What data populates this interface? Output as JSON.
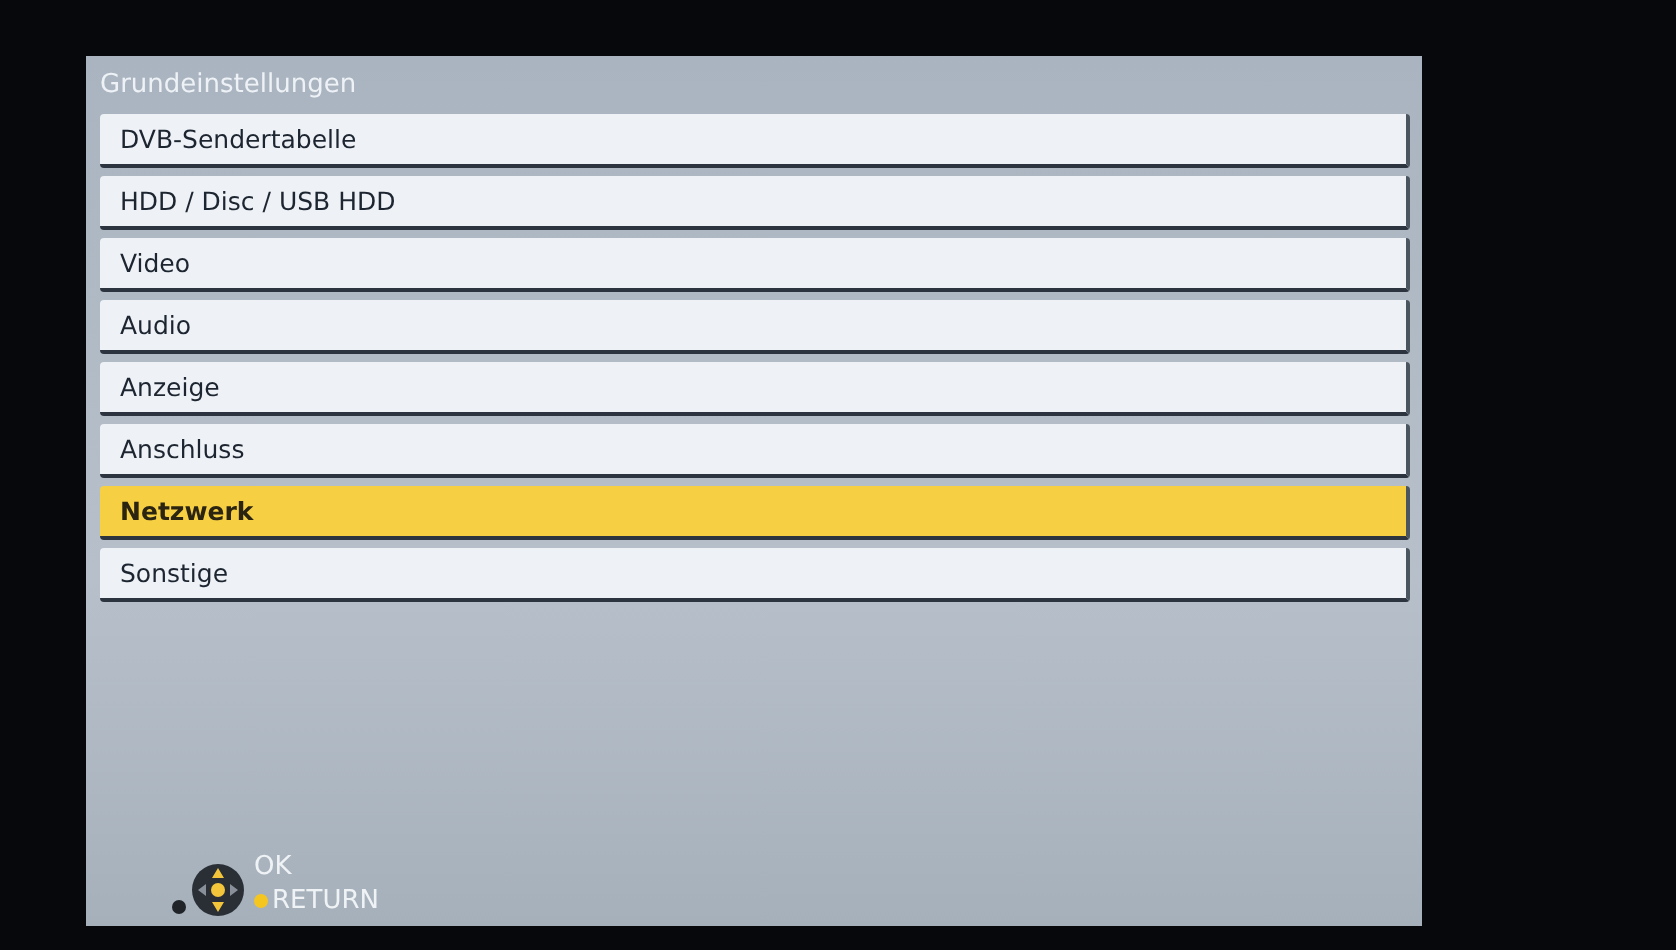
{
  "menu": {
    "title": "Grundeinstellungen",
    "items": [
      {
        "label": "DVB-Sendertabelle",
        "selected": false
      },
      {
        "label": "HDD / Disc / USB HDD",
        "selected": false
      },
      {
        "label": "Video",
        "selected": false
      },
      {
        "label": "Audio",
        "selected": false
      },
      {
        "label": "Anzeige",
        "selected": false
      },
      {
        "label": "Anschluss",
        "selected": false
      },
      {
        "label": "Netzwerk",
        "selected": true
      },
      {
        "label": "Sonstige",
        "selected": false
      }
    ]
  },
  "footer": {
    "ok_label": "OK",
    "return_label": "RETURN"
  }
}
